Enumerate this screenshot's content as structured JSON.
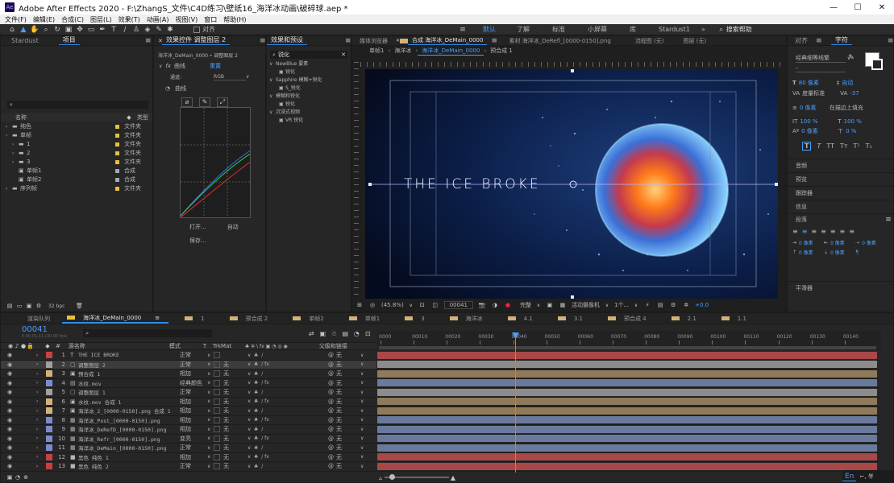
{
  "window": {
    "title": "Adobe After Effects 2020 - F:\\ZhangS_文件\\C4D练习\\壁纸16_海洋冰动画\\破碎球.aep *",
    "min": "—",
    "max": "☐",
    "close": "✕",
    "app_icon": "Ae"
  },
  "menu": [
    "文件(F)",
    "编辑(E)",
    "合成(C)",
    "图层(L)",
    "效果(T)",
    "动画(A)",
    "视图(V)",
    "窗口",
    "帮助(H)"
  ],
  "toolbar": {
    "align_label": "对齐",
    "workspaces": [
      "默认",
      "了解",
      "标准",
      "小屏幕",
      "库",
      "Stardust1"
    ],
    "search_placeholder": "搜索帮助",
    "overflow": "»"
  },
  "project": {
    "tabs": [
      "Stardust",
      "项目"
    ],
    "search_placeholder": "",
    "col_name": "名称",
    "col_type": "类型",
    "items": [
      {
        "name": "纯色",
        "type": "文件夹",
        "color": "#e8c13a",
        "indent": 0,
        "kind": "folder"
      },
      {
        "name": "单帧",
        "type": "文件夹",
        "color": "#e8c13a",
        "indent": 0,
        "kind": "folder"
      },
      {
        "name": "1",
        "type": "文件夹",
        "color": "#e8c13a",
        "indent": 1,
        "kind": "folder"
      },
      {
        "name": "2",
        "type": "文件夹",
        "color": "#e8c13a",
        "indent": 1,
        "kind": "folder"
      },
      {
        "name": "3",
        "type": "文件夹",
        "color": "#e8c13a",
        "indent": 1,
        "kind": "folder"
      },
      {
        "name": "单帧1",
        "type": "合成",
        "color": "#a9a9a9",
        "indent": 1,
        "kind": "comp"
      },
      {
        "name": "单帧2",
        "type": "合成",
        "color": "#a9a9a9",
        "indent": 1,
        "kind": "comp"
      },
      {
        "name": "序列帧",
        "type": "文件夹",
        "color": "#e8c13a",
        "indent": 0,
        "kind": "folder"
      }
    ],
    "bpc": "32 bpc"
  },
  "effects": {
    "tab": "效果控件 调整图层 2",
    "layer_path": "海洋冰_DeMain_0000 • 调整图层 2",
    "fx_name": "曲线",
    "reset": "重置",
    "channel_label": "通道:",
    "channel_value": "RGB",
    "curve_label": "曲线",
    "btn_open": "打开...",
    "btn_auto": "自动",
    "btn_save": "保存..."
  },
  "presets": {
    "tab": "效果和预设",
    "search_value": "锐化",
    "items": [
      {
        "label": "NewBlue 要素",
        "indent": 0
      },
      {
        "label": "锐化",
        "indent": 1
      },
      {
        "label": "Sapphire 模糊+锐化",
        "indent": 0
      },
      {
        "label": "S_锐化",
        "indent": 1
      },
      {
        "label": "模糊和锐化",
        "indent": 0
      },
      {
        "label": "锐化",
        "indent": 1
      },
      {
        "label": "沉浸式视频",
        "indent": 0
      },
      {
        "label": "VR 锐化",
        "indent": 1
      }
    ]
  },
  "composition": {
    "tabs": [
      "媒体浏览器",
      "合成 海洋冰_DeMain_0000",
      "素材 海洋冰_DeRefl_[0000-0150].png",
      "流程图 (无)",
      "图层 (无)"
    ],
    "crumbs": [
      "单帧1",
      "海洋冰",
      "海洋冰_DeMain_0000",
      "预合成 1"
    ],
    "title_text": "THE ICE BROKE",
    "footer": {
      "zoom": "(45.8%)",
      "frame": "00041",
      "quality": "完整",
      "camera": "活动摄像机",
      "views": "1个...",
      "exposure": "+0.0"
    }
  },
  "character": {
    "tabs": [
      "对齐",
      "字符"
    ],
    "font": "经典细等线繁",
    "font_style": "-",
    "size": "80 像素",
    "leading": "自动",
    "kerning": "度量标准",
    "tracking": "-37",
    "stroke": "0 像素",
    "stroke_mode": "在描边上填充",
    "vscale": "100 %",
    "hscale": "100 %",
    "baseline": "0 像素",
    "tsume": "0 %",
    "styles": [
      "T",
      "T",
      "TT",
      "Tт",
      "T¹",
      "T₁"
    ],
    "panels": [
      "音频",
      "预览",
      "跟踪器",
      "信息",
      "段落",
      "平滑器"
    ],
    "para_indent": [
      "0 像素",
      "0 像素",
      "0 像素",
      "0 像素",
      "0 像素"
    ]
  },
  "timeline": {
    "tabs": [
      "渲染队列",
      "海洋冰_DeMain_0000",
      "1",
      "预合成 2",
      "单帧2",
      "单帧1",
      "3",
      "海洋冰",
      "4.1",
      "3.1",
      "预合成 4",
      "2.1",
      "1.1"
    ],
    "timecode": "00041",
    "timecode_sub": "0:00:01:11 (30.00 fps)",
    "cols": {
      "name": "源名称",
      "mode": "模式",
      "t": "T",
      "trk": "TrkMat",
      "parent": "父级和链接"
    },
    "ticks": [
      "0000",
      "00010",
      "00020",
      "00030",
      "00040",
      "00050",
      "00060",
      "00070",
      "00080",
      "00090",
      "00100",
      "00110",
      "00120",
      "00130",
      "00140"
    ],
    "layers": [
      {
        "n": "1",
        "name": "THE ICE BROKE",
        "color": "#c94040",
        "mode": "正常",
        "trk": "",
        "parent": "无",
        "type": "T",
        "bar": "#a84848",
        "visible": true
      },
      {
        "n": "2",
        "name": "调整图层 2",
        "color": "#a0a0a0",
        "mode": "正常",
        "trk": "无",
        "parent": "无",
        "type": "adj",
        "bar": "#8c8c8c",
        "visible": true,
        "selected": true
      },
      {
        "n": "3",
        "name": "预合成 1",
        "color": "#d3b17a",
        "mode": "相加",
        "trk": "无",
        "parent": "无",
        "type": "comp",
        "bar": "#907a5a",
        "visible": true
      },
      {
        "n": "4",
        "name": "水纹.mov",
        "color": "#7b8ccc",
        "mode": "经典颜色",
        "trk": "无",
        "parent": "无",
        "type": "mov",
        "bar": "#6a7a9c",
        "visible": true
      },
      {
        "n": "5",
        "name": "调整图层 1",
        "color": "#a0a0a0",
        "mode": "正常",
        "trk": "无",
        "parent": "无",
        "type": "adj",
        "bar": "#8c8c8c",
        "visible": true
      },
      {
        "n": "6",
        "name": "水纹.mov 合成 1",
        "color": "#d3b17a",
        "mode": "相加",
        "trk": "无",
        "parent": "无",
        "type": "comp",
        "bar": "#907a5a",
        "visible": true
      },
      {
        "n": "7",
        "name": "海洋冰_2_[0000-0150].png 合成 1",
        "color": "#d3b17a",
        "mode": "相加",
        "trk": "无",
        "parent": "无",
        "type": "comp",
        "bar": "#907a5a",
        "visible": true
      },
      {
        "n": "8",
        "name": "海洋冰_Post_[0000-0150].png",
        "color": "#7b8ccc",
        "mode": "相加",
        "trk": "无",
        "parent": "无",
        "type": "png",
        "bar": "#6a7a9c",
        "visible": true
      },
      {
        "n": "9",
        "name": "海洋冰_DeRefD_[0000-0150].png",
        "color": "#7b8ccc",
        "mode": "相加",
        "trk": "无",
        "parent": "无",
        "type": "png",
        "bar": "#6a7a9c",
        "visible": true
      },
      {
        "n": "10",
        "name": "海洋冰_Refr_[0000-0150].png",
        "color": "#7b8ccc",
        "mode": "变亮",
        "trk": "无",
        "parent": "无",
        "type": "png",
        "bar": "#6a7a9c",
        "visible": true
      },
      {
        "n": "11",
        "name": "海洋冰_DeMain_[0000-0150].png",
        "color": "#7b8ccc",
        "mode": "正常",
        "trk": "无",
        "parent": "无",
        "type": "png",
        "bar": "#6a7a9c",
        "visible": true
      },
      {
        "n": "12",
        "name": "黑色 纯色 1",
        "color": "#c94040",
        "mode": "相加",
        "trk": "无",
        "parent": "无",
        "type": "solid",
        "bar": "#a84848",
        "visible": true
      },
      {
        "n": "13",
        "name": "黑色 纯色 2",
        "color": "#c94040",
        "mode": "正常",
        "trk": "无",
        "parent": "无",
        "type": "solid",
        "bar": "#a84848",
        "visible": true
      }
    ]
  },
  "taskbar": {
    "ime": "En",
    "symbols": "⌐, 半"
  },
  "colors": {
    "accent": "#2d8ceb",
    "panel": "#262626",
    "bg": "#232323"
  }
}
